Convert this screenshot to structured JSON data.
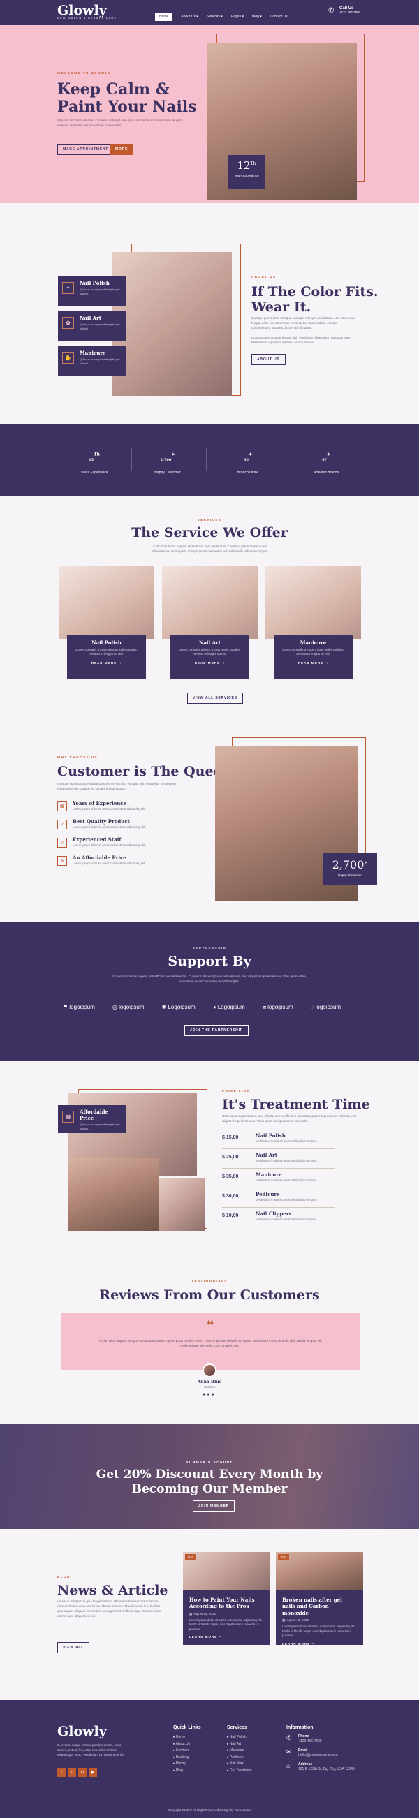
{
  "header": {
    "logo": "Glowly",
    "tagline": "NAIL SALON & BEAUTY CARE",
    "nav": [
      "Home",
      "About Us ▾",
      "Services ▾",
      "Pages ▾",
      "Blog ▾",
      "Contact Us"
    ],
    "call_label": "Call Us",
    "call_number": "+123 456 7890"
  },
  "hero": {
    "tag": "WELCOME TO GLOWLY",
    "title_1": "Keep Calm &",
    "title_2": "Paint Your Nails",
    "text": "Aliquam tincidunt vivamus. Curabitur volutpat sem quis sollicitudin orci. Maecenas feugiat vehicula imperdiet nec accumsan consectetur.",
    "btn1": "MAKE APPOINTMENT",
    "btn2": "MORE",
    "badge_num": "12",
    "badge_sup": "Th",
    "badge_label": "Years Experience"
  },
  "about": {
    "cards": [
      {
        "title": "Nail Polish",
        "text": "Quisque purus porta feugiat quis nisl vel."
      },
      {
        "title": "Nail Art",
        "text": "Quisque purus porta feugiat quis nisl vel."
      },
      {
        "title": "Manicure",
        "text": "Quisque purus porta feugiat quis nisl vel."
      }
    ],
    "tag": "ABOUT US",
    "title_1": "If The Color Fits.",
    "title_2": "Wear It.",
    "text1": "Quisque purus diam tristique. Volutpat nisl quis, sollicitudin erat. Maecenas feugiat dolor nisl accumsan consectetur. Suspendisse et nulla condimentum, sodales dictum nisl dictumst.",
    "text2": "Duis posuere congue feugiat nisi. Vestibulum bibendum risus quis eget. Fermentum dignissim eleifend ornare massa.",
    "btn": "ABOUT US"
  },
  "stats": [
    {
      "num": "15",
      "sup": "Th",
      "label": "Years Experience"
    },
    {
      "num": "2,700",
      "sup": "+",
      "label": "Happy Customer"
    },
    {
      "num": "30",
      "sup": "+",
      "label": "Branch Office"
    },
    {
      "num": "47",
      "sup": "+",
      "label": "Affiliated Brands"
    }
  ],
  "services": {
    "tag": "SERVICES",
    "title": "The Service We Offer",
    "text": "Ut tincidunt turpis sapien, sed efficitur sem eleifend in. Curabitur placerat purus nisl. Pellentesque. Proin porta non ipsum nisi venenatis vel, sollicitudin vehicula congue.",
    "cards": [
      {
        "title": "Nail Polish",
        "text": "Donec convallis a fusce a justo mollis sodales. Aenean et feugiat eu nisl.",
        "more": "READ MORE ➝"
      },
      {
        "title": "Nail Art",
        "text": "Donec convallis a fusce a justo mollis sodales. Aenean et feugiat eu nisl.",
        "more": "READ MORE ➝"
      },
      {
        "title": "Manicure",
        "text": "Donec convallis a fusce a justo mollis sodales. Aenean et feugiat eu nisl.",
        "more": "READ MORE ➝"
      }
    ],
    "btn": "VIEW ALL SERVICES"
  },
  "why": {
    "tag": "WHY CHOOSE US",
    "title": "Customer is The Queen",
    "text": "Quisque purus porta. Feugiat quis nisl vel porttitor volutpat nisi. Phasellus consectetur. Himenaeos nec congue ex sagittis pretium quam.",
    "items": [
      {
        "title": "Years of Experience",
        "text": "Lorem ipsum dolor sit amet, consectetur adipiscing elit."
      },
      {
        "title": "Best Quality Product",
        "text": "Lorem ipsum dolor sit amet, consectetur adipiscing elit."
      },
      {
        "title": "Experienced Staff",
        "text": "Lorem ipsum dolor sit amet, consectetur adipiscing elit."
      },
      {
        "title": "An Affordable Price",
        "text": "Lorem ipsum dolor sit amet, consectetur adipiscing elit."
      }
    ],
    "badge_num": "2,700",
    "badge_sup": "+",
    "badge_label": "Happy Customer"
  },
  "partners": {
    "tag": "PARTNERSHIP",
    "title": "Support By",
    "text": "Ut tincidunt turpis sapien, sed efficitur sem eleifend in. Curabitur placerat purus nisl vehicula, nec aliquet leo pellentesque. Cras quam vitae, accumsan nisi luctus vehicula nibh fringilla.",
    "logos": [
      "logoipsum",
      "logoipsum",
      "Logoipsum",
      "Logoipsum",
      "logoipsum",
      "logoipsum"
    ],
    "btn": "JOIN THE PARTNERSHIP"
  },
  "pricing": {
    "card_title": "Affordable Price",
    "card_text": "Quisque purus porta feugiat quis nisl vel.",
    "tag": "PRICE LIST",
    "title": "It's Treatment Time",
    "text": "Ut tincidunt turpis sapien, sed efficitur sem eleifend in. Curabitur placerat purus nisl vehicula, nec aliquet leo pellentesque. Proin porta non ipsum nisi venenatis.",
    "items": [
      {
        "price": "$ 15,00",
        "name": "Nail Polish",
        "desc": "Vestibulum in nisi sit amet elit facilisis tempus."
      },
      {
        "price": "$ 25,00",
        "name": "Nail Art",
        "desc": "Vestibulum in nisi sit amet elit facilisis tempus."
      },
      {
        "price": "$ 35,00",
        "name": "Manicure",
        "desc": "Vestibulum in nisi sit amet elit facilisis tempus."
      },
      {
        "price": "$ 30,00",
        "name": "Pedicure",
        "desc": "Vestibulum in nisi sit amet elit facilisis tempus."
      },
      {
        "price": "$ 10,00",
        "name": "Nail Clippers",
        "desc": "Vestibulum in nisi sit amet elit facilisis tempus."
      }
    ]
  },
  "reviews": {
    "tag": "TESTIMONIALS",
    "title": "Reviews From Our Customers",
    "quote": "\"Ac sit nulla, aliquam tempus consequat tincidunt quam porta pretium lorem. Hunc imperdiet velit elit vel quam. Vestibulum in nisi sit amet nibh lacinia tempus elit. Pellentesque felis velit. Cras ornare id elit.\"",
    "name": "Anna Blue",
    "role": "Student"
  },
  "promo": {
    "tag": "SUMMER DISCOUNT",
    "title_1": "Get 20% Discount Every Month by",
    "title_2": "Becoming Our Member",
    "btn": "JOIN MEMBER"
  },
  "blog": {
    "tag": "BLOG",
    "title": "News & Article",
    "text": "Vivamus volutpat mi quis feugiat rutrum. Phasellus tincidunt tortor lacinia. Aenean finibus arcu non lorem lobortis posuere. Mauris lorem leo, facilisis quis augue. Aliquam fermentum nec eget velit. Pellentesque sit amet purus elementum, aliquet sed nisi.",
    "btn": "VIEW ALL",
    "posts": [
      {
        "badge": "Nail",
        "title": "How to Paint Your Nails According to the Pros",
        "date": "August 15, 2022",
        "text": "Lorem ipsum dolor sit amet, consectetur adipiscing elit. Morbi ut blandit turpis, quis dapibus arcu. Aenean ut pulvinar.",
        "more": "LEARN MORE ➝"
      },
      {
        "badge": "Tips",
        "title": "Broken nails after gel nails and Carbon monoxide",
        "date": "August 15, 2022",
        "text": "Lorem ipsum dolor sit amet, consectetur adipiscing elit. Morbi ut blandit turpis, quis dapibus arcu. Aenean ut pulvinar.",
        "more": "LEARN MORE ➝"
      }
    ]
  },
  "footer": {
    "logo": "Glowly",
    "text": "In viverra, neque tempor porttitor ornare, justo sapien pretium leo, vitae imperdiet velit nisi ullamcorper nunc. Vestibulum et massa ac enim.",
    "quick_title": "Quick Links",
    "quick": [
      "Home",
      "About Us",
      "Services",
      "Booking",
      "Pricing",
      "Blog"
    ],
    "services_title": "Services",
    "services": [
      "Nail Polish",
      "Nail Art",
      "Manicure",
      "Pedicure",
      "Nail Wax",
      "Gel Treatment"
    ],
    "info_title": "Information",
    "phone_label": "Phone",
    "phone": "+123 456 7890",
    "email_label": "Email",
    "email": "hello@yoursitename.com",
    "address_label": "Address",
    "address": "101 E 129th St, Big City, USA 12345",
    "copyright": "Copyright 2022 © All Right Reserved Design by Rometheme"
  }
}
